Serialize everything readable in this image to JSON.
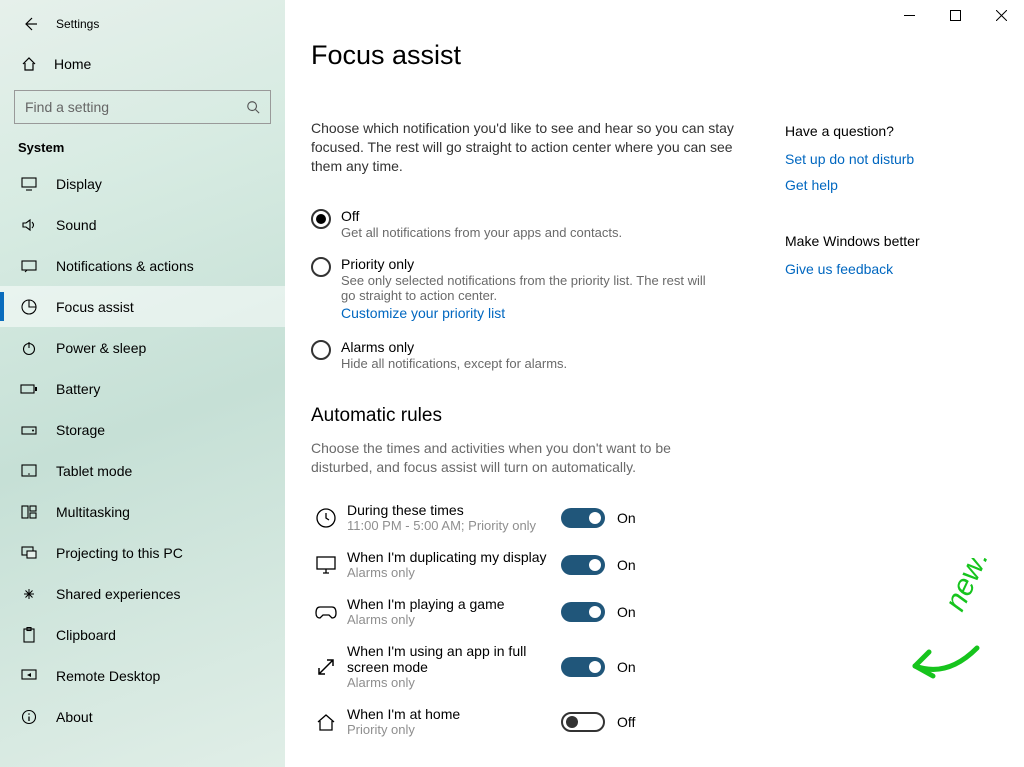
{
  "window": {
    "title": "Settings"
  },
  "sidebar": {
    "home": "Home",
    "search_placeholder": "Find a setting",
    "section": "System",
    "items": [
      {
        "label": "Display"
      },
      {
        "label": "Sound"
      },
      {
        "label": "Notifications & actions"
      },
      {
        "label": "Focus assist"
      },
      {
        "label": "Power & sleep"
      },
      {
        "label": "Battery"
      },
      {
        "label": "Storage"
      },
      {
        "label": "Tablet mode"
      },
      {
        "label": "Multitasking"
      },
      {
        "label": "Projecting to this PC"
      },
      {
        "label": "Shared experiences"
      },
      {
        "label": "Clipboard"
      },
      {
        "label": "Remote Desktop"
      },
      {
        "label": "About"
      }
    ]
  },
  "page": {
    "title": "Focus assist",
    "description": "Choose which notification you'd like to see and hear so you can stay focused. The rest will go straight to action center where you can see them any time.",
    "radios": {
      "off": {
        "label": "Off",
        "sub": "Get all notifications from your apps and contacts."
      },
      "priority": {
        "label": "Priority only",
        "sub": "See only selected notifications from the priority list. The rest will go straight to action center.",
        "link": "Customize your priority list"
      },
      "alarms": {
        "label": "Alarms only",
        "sub": "Hide all notifications, except for alarms."
      }
    },
    "rules_heading": "Automatic rules",
    "rules_desc": "Choose the times and activities when you don't want to be disturbed, and focus assist will turn on automatically.",
    "rules": [
      {
        "title": "During these times",
        "sub": "11:00 PM - 5:00 AM; Priority only",
        "state": "On"
      },
      {
        "title": "When I'm duplicating my display",
        "sub": "Alarms only",
        "state": "On"
      },
      {
        "title": "When I'm playing a game",
        "sub": "Alarms only",
        "state": "On"
      },
      {
        "title": "When I'm using an app in full screen mode",
        "sub": "Alarms only",
        "state": "On"
      },
      {
        "title": "When I'm at home",
        "sub": "Priority only",
        "state": "Off"
      }
    ],
    "toggle_on": "On",
    "toggle_off": "Off"
  },
  "aside": {
    "question_heading": "Have a question?",
    "dnd_link": "Set up do not disturb",
    "help_link": "Get help",
    "better_heading": "Make Windows better",
    "feedback_link": "Give us feedback"
  },
  "annotation": {
    "text": "new!"
  }
}
